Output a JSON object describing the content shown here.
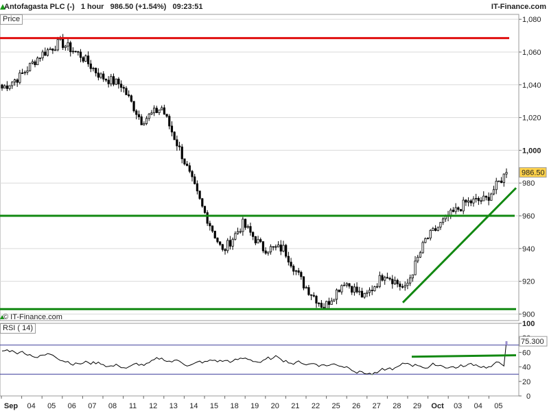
{
  "header": {
    "instrument": "Antofagasta PLC (-)",
    "timeframe": "1 hour",
    "last_price": "986.50 (+1.54%)",
    "time": "09:23:51",
    "brand": "IT-Finance.com"
  },
  "watermark": "© IT-Finance.com",
  "colors": {
    "resistance": "#e01010",
    "support": "#118811",
    "candle_up": "#ffffff",
    "candle_down": "#000000",
    "rsi_line": "#000000",
    "rsi_overbought_fill": "#9b8fd0",
    "rsi_oversold_fill": "#8fbf8f",
    "price_tag_bg": "#ffd24a",
    "rsi_tag_bg": "#ffffff"
  },
  "chart_data": [
    {
      "type": "candlestick",
      "pane_label": "Price",
      "title": "Antofagasta PLC (-)",
      "timeframe": "1 hour",
      "y_ticks": [
        "1,080",
        "1,060",
        "1,040",
        "1,020",
        "1,000",
        "980",
        "960",
        "940",
        "920",
        "900"
      ],
      "ylim": [
        896,
        1083
      ],
      "last_price_label": "986.50",
      "last_price": 986.5,
      "horizontal_lines": [
        {
          "name": "resistance",
          "value": 1068.5
        },
        {
          "name": "support",
          "value": 960
        },
        {
          "name": "support",
          "value": 903
        }
      ],
      "trendlines": [
        {
          "name": "rising-trend",
          "from": {
            "date": "28",
            "value": 907
          },
          "to": {
            "date": "05",
            "value": 977
          }
        }
      ],
      "closes_approx": [
        {
          "date": "Sep 03",
          "close": 1045
        },
        {
          "date": "04",
          "close": 1058
        },
        {
          "date": "05",
          "close": 1066
        },
        {
          "date": "06",
          "close": 1058
        },
        {
          "date": "07",
          "close": 1045
        },
        {
          "date": "08",
          "close": 1040
        },
        {
          "date": "11",
          "close": 1018
        },
        {
          "date": "12",
          "close": 1026
        },
        {
          "date": "13",
          "close": 997
        },
        {
          "date": "14",
          "close": 965
        },
        {
          "date": "15",
          "close": 938
        },
        {
          "date": "18",
          "close": 955
        },
        {
          "date": "19",
          "close": 940
        },
        {
          "date": "20",
          "close": 940
        },
        {
          "date": "21",
          "close": 918
        },
        {
          "date": "22",
          "close": 904
        },
        {
          "date": "25",
          "close": 920
        },
        {
          "date": "26",
          "close": 910
        },
        {
          "date": "27",
          "close": 925
        },
        {
          "date": "28",
          "close": 915
        },
        {
          "date": "29",
          "close": 945
        },
        {
          "date": "Oct 02",
          "close": 958
        },
        {
          "date": "03",
          "close": 968
        },
        {
          "date": "04",
          "close": 970
        },
        {
          "date": "05",
          "close": 986.5
        }
      ]
    },
    {
      "type": "line",
      "pane_label": "RSI ( 14)",
      "y_ticks": [
        "100",
        "80",
        "60",
        "40",
        "20",
        "0"
      ],
      "ylim": [
        0,
        100
      ],
      "reference_lines": [
        70,
        30
      ],
      "last_value_label": "75.300",
      "last_value": 75.3,
      "trendline": {
        "from": {
          "date": "28",
          "value": 54
        },
        "to": {
          "date": "05",
          "value": 56
        }
      }
    }
  ],
  "x_axis": {
    "labels": [
      "Sep",
      "04",
      "05",
      "06",
      "07",
      "08",
      "11",
      "12",
      "13",
      "14",
      "15",
      "18",
      "19",
      "20",
      "21",
      "22",
      "25",
      "26",
      "27",
      "28",
      "29",
      "Oct",
      "03",
      "04",
      "05"
    ]
  }
}
